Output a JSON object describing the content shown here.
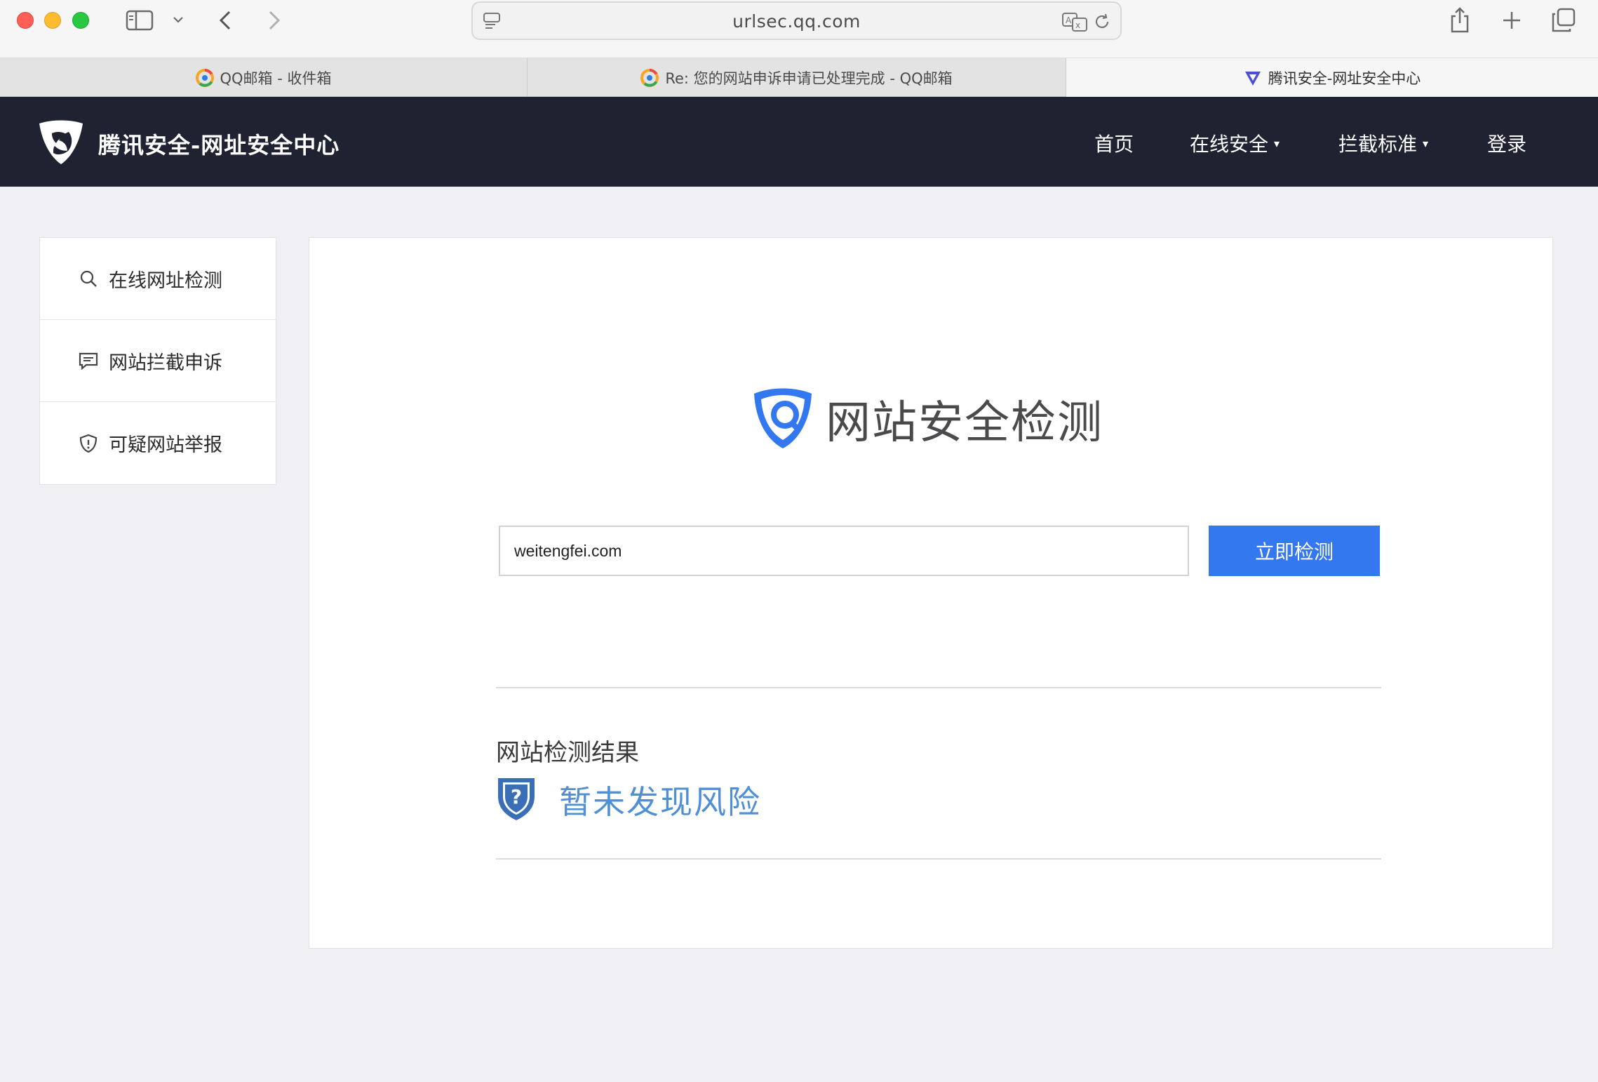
{
  "browser": {
    "url": "urlsec.qq.com",
    "tabs": [
      {
        "label": "QQ邮箱 - 收件箱",
        "active": false
      },
      {
        "label": "Re: 您的网站申诉申请已处理完成 - QQ邮箱",
        "active": false
      },
      {
        "label": "腾讯安全-网址安全中心",
        "active": true
      }
    ]
  },
  "header": {
    "brand": "腾讯安全-网址安全中心",
    "nav": [
      {
        "label": "首页",
        "has_dropdown": false
      },
      {
        "label": "在线安全",
        "has_dropdown": true
      },
      {
        "label": "拦截标准",
        "has_dropdown": true
      },
      {
        "label": "登录",
        "has_dropdown": false
      }
    ],
    "caret": "▾"
  },
  "sidebar": {
    "items": [
      {
        "label": "在线网址检测",
        "icon": "search-icon"
      },
      {
        "label": "网站拦截申诉",
        "icon": "comment-icon"
      },
      {
        "label": "可疑网站举报",
        "icon": "shield-alert-icon"
      }
    ]
  },
  "main": {
    "hero_title": "网站安全检测",
    "search": {
      "value": "weitengfei.com"
    },
    "check_button": "立即检测",
    "result_heading": "网站检测结果",
    "result_status": "暂未发现风险"
  },
  "colors": {
    "nav_bg": "#1f2230",
    "accent_blue": "#3478f0",
    "result_blue": "#4f8fd6"
  }
}
